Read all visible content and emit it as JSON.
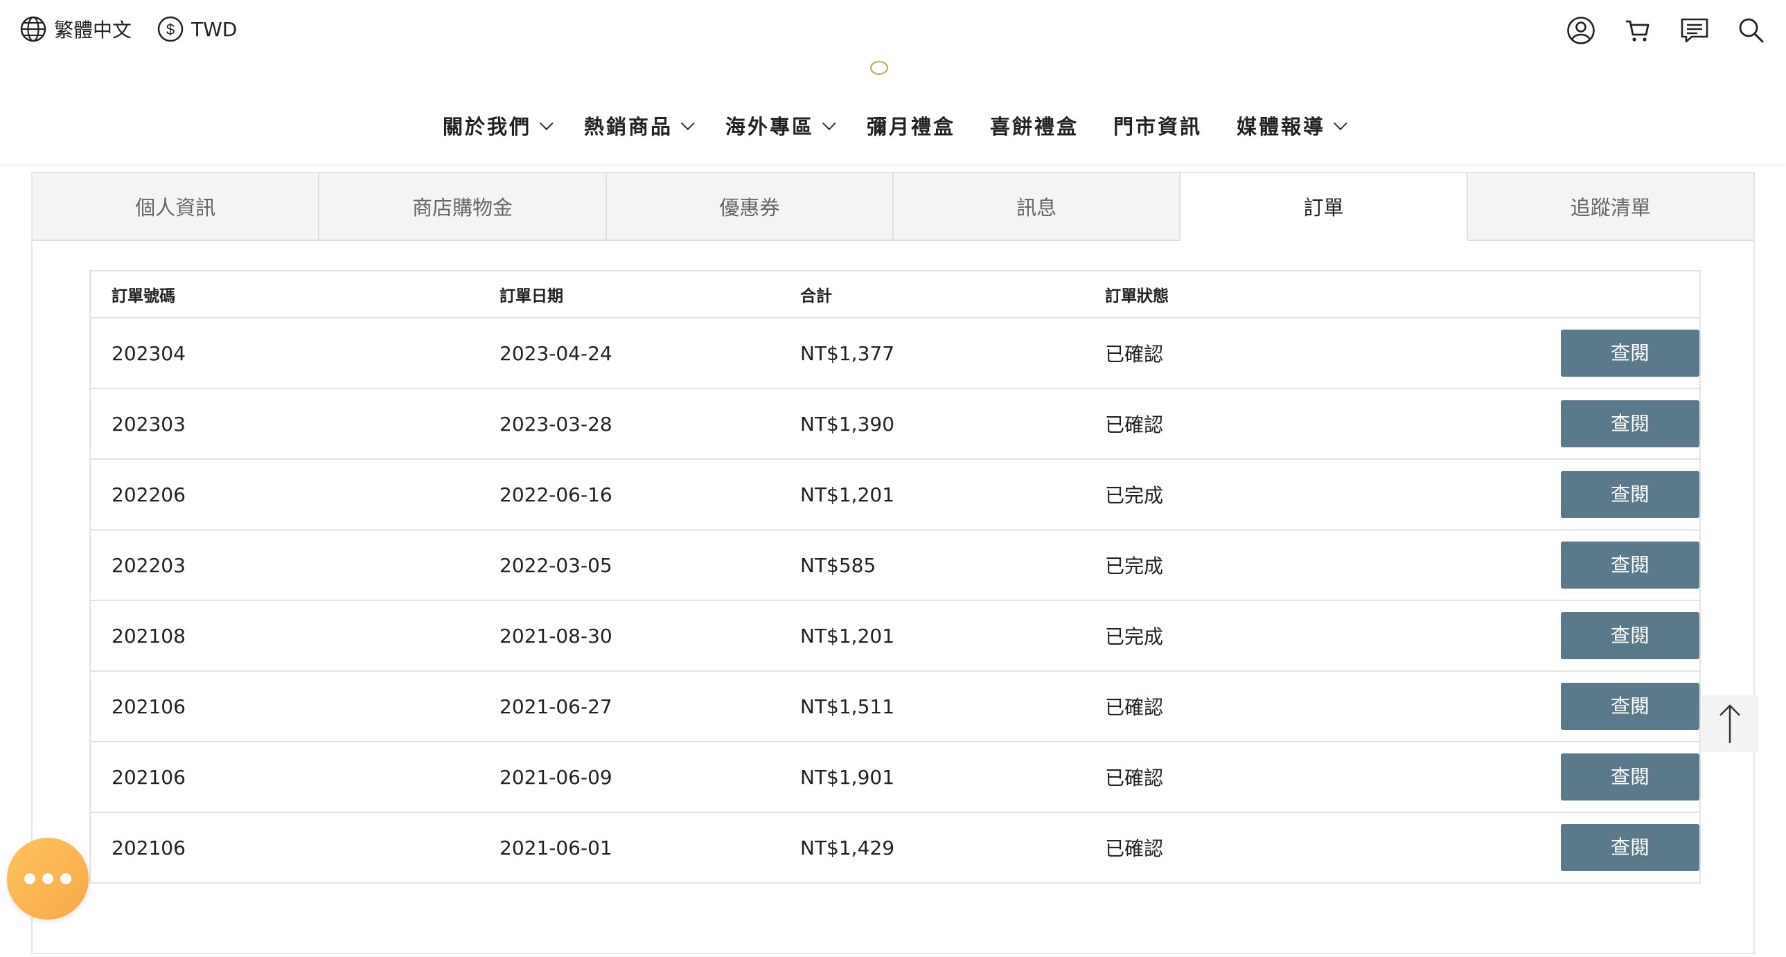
{
  "header": {
    "language": "繁體中文",
    "currency": "TWD",
    "icons": [
      "user-icon",
      "cart-icon",
      "message-icon",
      "search-icon"
    ],
    "nav": [
      {
        "label": "關於我們",
        "dropdown": true
      },
      {
        "label": "熱銷商品",
        "dropdown": true
      },
      {
        "label": "海外專區",
        "dropdown": true
      },
      {
        "label": "彌月禮盒",
        "dropdown": false
      },
      {
        "label": "喜餅禮盒",
        "dropdown": false
      },
      {
        "label": "門市資訊",
        "dropdown": false
      },
      {
        "label": "媒體報導",
        "dropdown": true
      }
    ]
  },
  "tabs": [
    {
      "label": "個人資訊",
      "active": false
    },
    {
      "label": "商店購物金",
      "active": false
    },
    {
      "label": "優惠券",
      "active": false
    },
    {
      "label": "訊息",
      "active": false
    },
    {
      "label": "訂單",
      "active": true
    },
    {
      "label": "追蹤清單",
      "active": false
    }
  ],
  "orders": {
    "headers": [
      "訂單號碼",
      "訂單日期",
      "合計",
      "訂單狀態"
    ],
    "view_label": "查閱",
    "rows": [
      {
        "no": "202304",
        "date": "2023-04-24",
        "total": "NT$1,377",
        "status": "已確認"
      },
      {
        "no": "202303",
        "date": "2023-03-28",
        "total": "NT$1,390",
        "status": "已確認"
      },
      {
        "no": "202206",
        "date": "2022-06-16",
        "total": "NT$1,201",
        "status": "已完成"
      },
      {
        "no": "202203",
        "date": "2022-03-05",
        "total": "NT$585",
        "status": "已完成"
      },
      {
        "no": "202108",
        "date": "2021-08-30",
        "total": "NT$1,201",
        "status": "已完成"
      },
      {
        "no": "202106",
        "date": "2021-06-27",
        "total": "NT$1,511",
        "status": "已確認"
      },
      {
        "no": "202106",
        "date": "2021-06-09",
        "total": "NT$1,901",
        "status": "已確認"
      },
      {
        "no": "202106",
        "date": "2021-06-01",
        "total": "NT$1,429",
        "status": "已確認"
      }
    ]
  },
  "colors": {
    "button": "#5a7a8c",
    "chat": "#ffc35c",
    "logo": "#c9a15a"
  }
}
